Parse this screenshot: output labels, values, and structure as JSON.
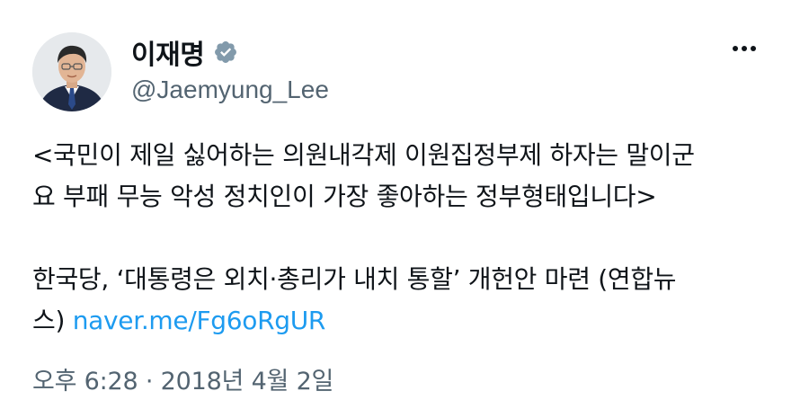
{
  "author": {
    "display_name": "이재명",
    "handle": "@Jaemyung_Lee",
    "verified": true,
    "verified_color": "#829aab"
  },
  "tweet": {
    "line1": "<국민이 제일 싫어하는 의원내각제 이원집정부제 하자는 말이군",
    "line2": "요 부패 무능 악성 정치인이 가장 좋아하는 정부형태입니다>",
    "line3": "한국당, ‘대통령은 외치·총리가 내치 통할’ 개헌안 마련 (연합뉴",
    "line4_prefix": "스) ",
    "link": "naver.me/Fg6oRgUR",
    "link_color": "#1d9bf0"
  },
  "meta": {
    "timestamp": "오후 6:28 · 2018년 4월 2일"
  },
  "icons": {
    "more": "more-horizontal-icon",
    "verified": "verified-badge-icon"
  }
}
